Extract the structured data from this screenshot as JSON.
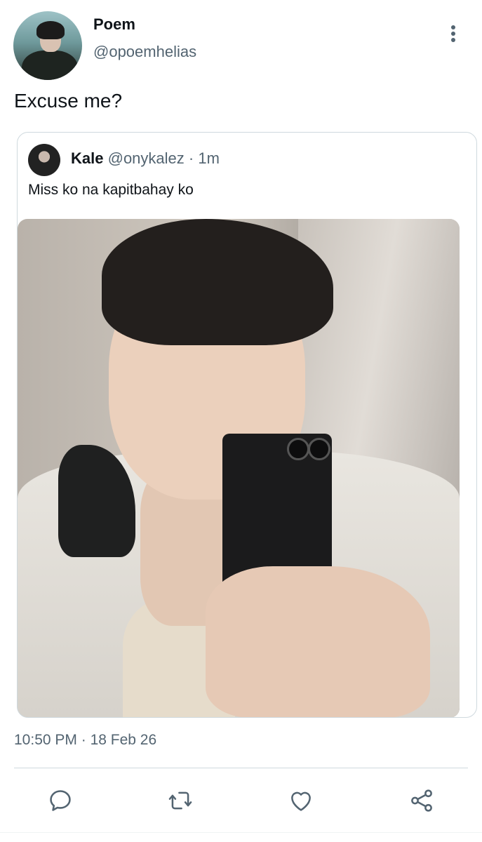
{
  "tweet": {
    "author_name": "Poem",
    "author_handle": "@opoemhelias",
    "text": "Excuse me?",
    "time": "10:50 PM",
    "separator": "·",
    "date": "18 Feb 26"
  },
  "quoted_tweet": {
    "author_name": "Kale",
    "author_handle": "@onykalez",
    "separator": "·",
    "time_ago": "1m",
    "text": "Miss ko na kapitbahay ko"
  },
  "actions": [
    {
      "icon": "reply-icon"
    },
    {
      "icon": "retweet-icon"
    },
    {
      "icon": "like-icon"
    },
    {
      "icon": "share-icon"
    }
  ],
  "colors": {
    "text_primary": "#0f1419",
    "text_secondary": "#536471",
    "border": "#cfd9de"
  }
}
